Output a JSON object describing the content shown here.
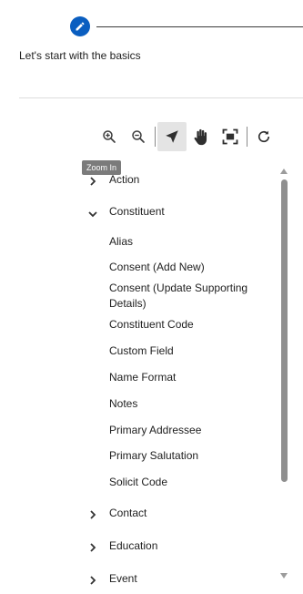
{
  "stepper": {
    "caption": "Let's start with the basics",
    "step_icon": "pencil-icon",
    "accent": "#0a5ec0"
  },
  "toolbar": {
    "items": [
      {
        "name": "zoom-in",
        "icon": "zoom-in-icon"
      },
      {
        "name": "zoom-out",
        "icon": "zoom-out-icon"
      },
      {
        "name": "select",
        "icon": "pointer-icon",
        "active": true
      },
      {
        "name": "pan",
        "icon": "hand-icon"
      },
      {
        "name": "fit",
        "icon": "fit-screen-icon"
      },
      {
        "name": "refresh",
        "icon": "refresh-icon"
      }
    ],
    "tooltip": "Zoom In"
  },
  "tree": {
    "action": "Action",
    "constituent": {
      "label": "Constituent",
      "expanded": true,
      "children": [
        "Alias",
        "Consent (Add New)",
        "Consent (Update Supporting Details)",
        "Constituent Code",
        "Custom Field",
        "Name Format",
        "Notes",
        "Primary Addressee",
        "Primary Salutation",
        "Solicit Code"
      ]
    },
    "contact": "Contact",
    "education": "Education",
    "event": "Event"
  }
}
